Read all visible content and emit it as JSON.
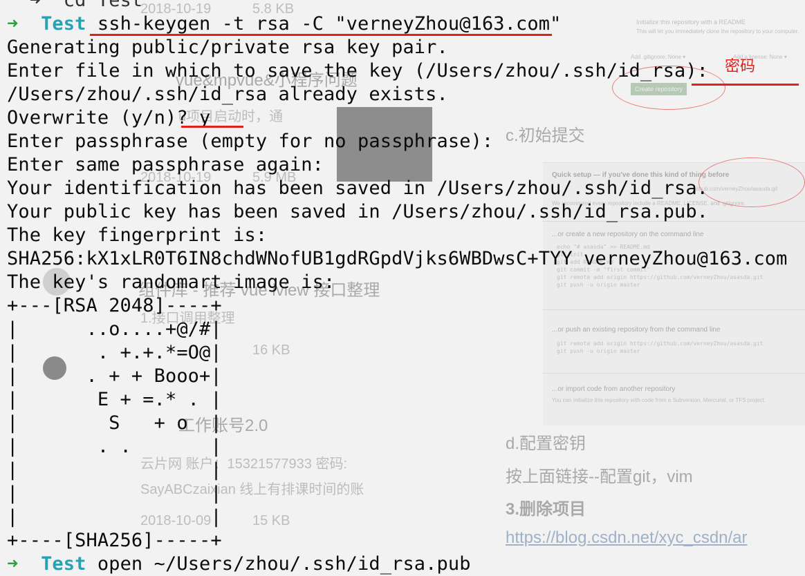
{
  "terminal": {
    "prompt_dir": "Test",
    "prompt_arrow": "➜",
    "lines": [
      {
        "kind": "partial",
        "text": "  ➜  cd Test"
      },
      {
        "kind": "prompt",
        "cmd": "ssh-keygen -t rsa -C \"verneyZhou@163.com\""
      },
      {
        "kind": "out",
        "text": "Generating public/private rsa key pair."
      },
      {
        "kind": "out",
        "text": "Enter file in which to save the key (/Users/zhou/.ssh/id_rsa):"
      },
      {
        "kind": "out",
        "text": "/Users/zhou/.ssh/id_rsa already exists."
      },
      {
        "kind": "out",
        "text": "Overwrite (y/n)? y"
      },
      {
        "kind": "out",
        "text": "Enter passphrase (empty for no passphrase):"
      },
      {
        "kind": "out",
        "text": "Enter same passphrase again:"
      },
      {
        "kind": "out",
        "text": "Your identification has been saved in /Users/zhou/.ssh/id_rsa."
      },
      {
        "kind": "out",
        "text": "Your public key has been saved in /Users/zhou/.ssh/id_rsa.pub."
      },
      {
        "kind": "out",
        "text": "The key fingerprint is:"
      },
      {
        "kind": "out",
        "text": "SHA256:kX1xLR0T6IN8chdWNofUB1gdRGpdVjks6WBDwsC+TYY verneyZhou@163.com"
      },
      {
        "kind": "out",
        "text": "The key's randomart image is:"
      },
      {
        "kind": "out",
        "text": "+---[RSA 2048]----+"
      },
      {
        "kind": "out",
        "text": "|      ..o....+@/#|"
      },
      {
        "kind": "out",
        "text": "|       . +.+.*=O@|"
      },
      {
        "kind": "out",
        "text": "|      . + + Booo+|"
      },
      {
        "kind": "out",
        "text": "|       E + =.* . |"
      },
      {
        "kind": "out",
        "text": "|        S   + o  |"
      },
      {
        "kind": "out",
        "text": "|       . .       |"
      },
      {
        "kind": "out",
        "text": "|                 |"
      },
      {
        "kind": "out",
        "text": "|                 |"
      },
      {
        "kind": "out",
        "text": "|                 |"
      },
      {
        "kind": "out",
        "text": "+----[SHA256]-----+"
      },
      {
        "kind": "prompt",
        "cmd": "open ~/Users/zhou/.ssh/id_rsa.pub"
      }
    ]
  },
  "annotation": {
    "label": "密码"
  },
  "background_doc": {
    "dates": [
      "2018-10-19",
      "2018-10-19",
      "2018-10-09"
    ],
    "sizes": [
      "5.8 KB",
      "5.9 MB",
      "16 KB",
      "15 KB"
    ],
    "titles": [
      "vue&mpvue&小程序问题",
      "u项目启动时，通",
      "组件库 - 推荐 vue iview 接口整理",
      "1.接口调用整理",
      "工作账号2.0"
    ],
    "account_line": "云片网 账户：15321577933 密码:",
    "account_line2": "SayABCzaixian 线上有排课时间的账",
    "section_c": "c.初始提交",
    "section_d": "d.配置密钥",
    "step_text": "按上面链接--配置git，vim",
    "delete_title": "3.删除项目",
    "link": "https://blog.csdn.net/xyc_csdn/ar",
    "gh_readme_title": "Initialize this repository with a README",
    "gh_readme_desc": "This will let you immediately clone the repository to your computer.",
    "gh_add": "Add .gitignore: None ▾",
    "gh_license": "Add a license: None ▾",
    "gh_create": "Create repository",
    "gh_quick": "Quick setup — if you've done this kind of thing before",
    "gh_url": "github.com/verneyZhou/asasda.git",
    "gh_recommend": "We recommend every repository include a README, LICENSE, and .gitignore.",
    "gh_cmdline_title": "...or create a new repository on the command line",
    "gh_cmd_lines": [
      "echo \"# asasda\" >> README.md",
      "git init",
      "git add README.md",
      "git commit -m \"first commit\"",
      "git remote add origin https://github.com/verneyZhou/asasda.git",
      "git push -u origin master"
    ],
    "gh_push_title": "...or push an existing repository from the command line",
    "gh_push_lines": [
      "git remote add origin https://github.com/verneyZhou/asasda.git",
      "git push -u origin master"
    ],
    "gh_import_title": "...or import code from another repository",
    "gh_import_desc": "You can initialize this repository with code from a Subversion, Mercurial, or TFS project."
  }
}
